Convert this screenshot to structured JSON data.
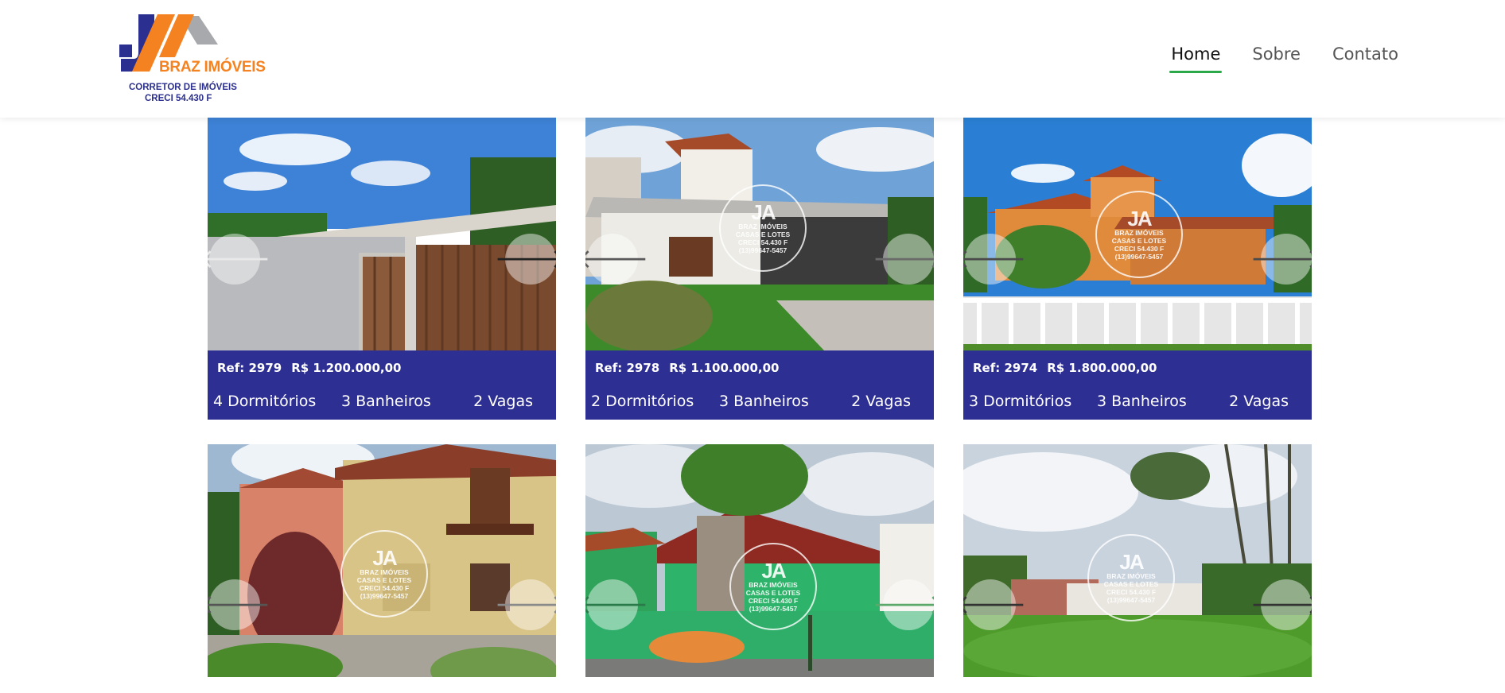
{
  "brand": {
    "name": "BRAZ IMÓVEIS",
    "subtitle": "CORRETOR DE IMÓVEIS",
    "creci": "CRECI 54.430 F",
    "colors": {
      "orange": "#f58220",
      "navy": "#2b2f8f",
      "gray": "#a7a9ac"
    }
  },
  "nav": {
    "items": [
      {
        "label": "Home",
        "active": true
      },
      {
        "label": "Sobre",
        "active": false
      },
      {
        "label": "Contato",
        "active": false
      }
    ],
    "active_color": "#2aa84a"
  },
  "watermark": {
    "mark": "JA",
    "name": "BRAZ IMÓVEIS",
    "tagline": "CASAS E LOTES",
    "creci": "CRECI 54.430 F",
    "phone": "(13)99647-5457"
  },
  "listings": [
    {
      "ref": "Ref: 2979",
      "price": "R$ 1.200.000,00",
      "bedrooms": "4 Dormitórios",
      "bathrooms": "3 Banheiros",
      "parking": "2 Vagas"
    },
    {
      "ref": "Ref: 2978",
      "price": "R$ 1.100.000,00",
      "bedrooms": "2 Dormitórios",
      "bathrooms": "3 Banheiros",
      "parking": "2 Vagas"
    },
    {
      "ref": "Ref: 2974",
      "price": "R$ 1.800.000,00",
      "bedrooms": "3 Dormitórios",
      "bathrooms": "3 Banheiros",
      "parking": "2 Vagas"
    },
    {
      "ref": "",
      "price": "",
      "bedrooms": "",
      "bathrooms": "",
      "parking": ""
    },
    {
      "ref": "",
      "price": "",
      "bedrooms": "",
      "bathrooms": "",
      "parking": ""
    },
    {
      "ref": "",
      "price": "",
      "bedrooms": "",
      "bathrooms": "",
      "parking": ""
    }
  ],
  "carousel": {
    "prev_icon": "arrow-left-icon",
    "next_icon": "arrow-right-icon",
    "prev_glyph": "🡐",
    "next_glyph": "🡒"
  },
  "card_colors": {
    "info_bg": "#2e2f93"
  }
}
